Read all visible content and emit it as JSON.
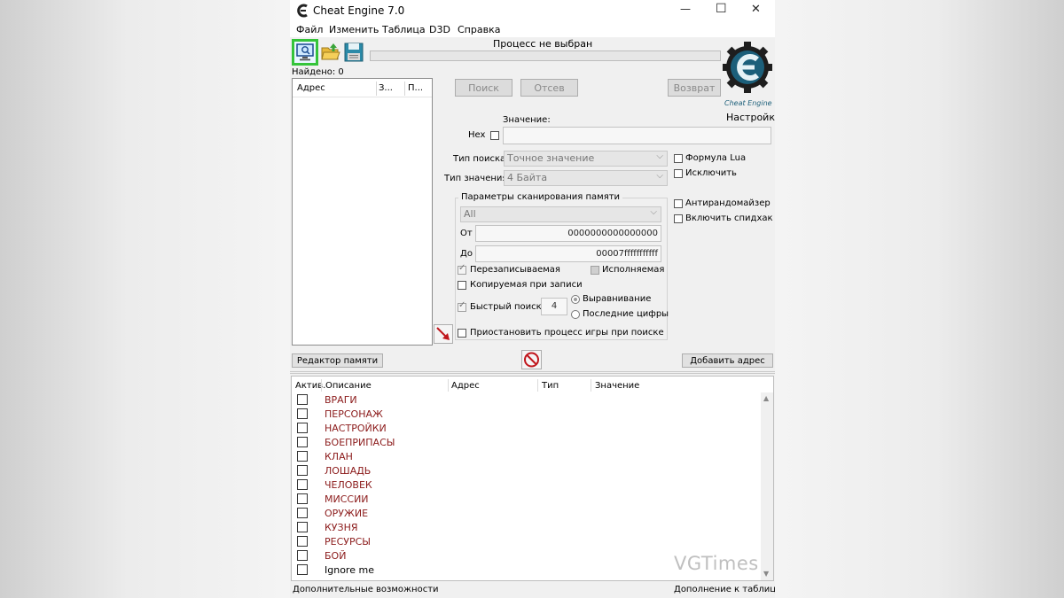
{
  "window": {
    "title": "Cheat Engine 7.0",
    "minimize": "—",
    "maximize": "☐",
    "close": "✕"
  },
  "menu": [
    "Файл",
    "Изменить",
    "Таблица",
    "D3D",
    "Справка"
  ],
  "process_status": "Процесс не выбран",
  "found_count": "Найдено: 0",
  "results_columns": [
    "Адрес",
    "З...",
    "П..."
  ],
  "buttons": {
    "search": "Поиск",
    "filter": "Отсев",
    "undo": "Возврат",
    "settings": "Настройки",
    "memory_view": "Редактор памяти",
    "add_address": "Добавить адрес"
  },
  "logo_caption": "Cheat Engine",
  "value_label": "Значение:",
  "hex_label": "Hex",
  "scan_type": {
    "label": "Тип поиска",
    "selected": "Точное значение"
  },
  "value_type": {
    "label": "Тип значения",
    "selected": "4 Байта"
  },
  "right_options": {
    "lua_formula": "Формула Lua",
    "not": "Исключить",
    "unrandomizer": "Антирандомайзер",
    "speedhack": "Включить спидхак"
  },
  "memory_scan": {
    "title": "Параметры сканирования памяти",
    "region": "All",
    "from_label": "От",
    "from_value": "0000000000000000",
    "to_label": "До",
    "to_value": "00007fffffffffff",
    "writable": "Перезаписываемая",
    "executable": "Исполняемая",
    "copy_on_write": "Копируемая при записи",
    "fast_scan": "Быстрый поиск",
    "fast_scan_value": "4",
    "alignment": "Выравнивание",
    "last_digits": "Последние цифры",
    "pause_game": "Приостановить процесс игры при поиске"
  },
  "table_columns": {
    "active": "Актив.",
    "description": "Описание",
    "address": "Адрес",
    "type": "Тип",
    "value": "Значение"
  },
  "table_rows": [
    "ВРАГИ",
    "ПЕРСОНАЖ",
    "НАСТРОЙКИ",
    "БОЕПРИПАСЫ",
    "КЛАН",
    "ЛОШАДЬ",
    "ЧЕЛОВЕК",
    "МИССИИ",
    "ОРУЖИЕ",
    "КУЗНЯ",
    "РЕСУРСЫ",
    "БОЙ",
    "Ignore me"
  ],
  "footer": {
    "left": "Дополнительные возможности",
    "right": "Дополнение к таблице"
  },
  "watermark": "VGTimes",
  "colors": {
    "highlight": "#35c43a",
    "row_text": "#8b1a1a",
    "logo": "#1c5f7a"
  }
}
